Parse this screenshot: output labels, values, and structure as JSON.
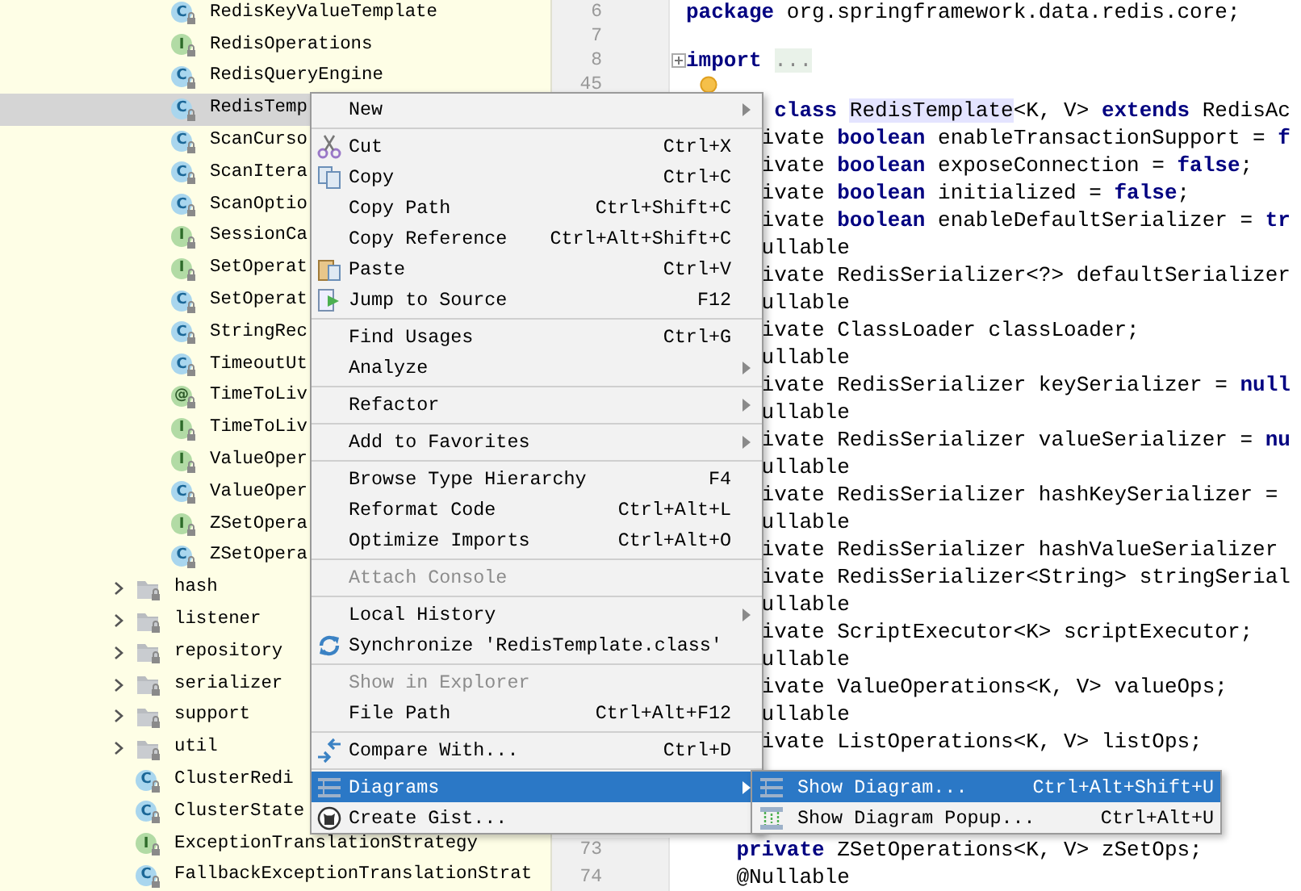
{
  "project_tree": {
    "items": [
      {
        "children": [
          {
            "label": "RedisKeyValueTemplate",
            "kind": "class",
            "icon_letter": "C",
            "selected": false
          },
          {
            "label": "RedisOperations",
            "kind": "interface",
            "icon_letter": "I",
            "selected": false
          },
          {
            "label": "RedisQueryEngine",
            "kind": "class",
            "icon_letter": "C",
            "selected": false
          },
          {
            "label": "RedisTemp",
            "kind": "class",
            "icon_letter": "C",
            "selected": true
          },
          {
            "label": "ScanCurso",
            "kind": "class",
            "icon_letter": "C",
            "selected": false
          },
          {
            "label": "ScanItera",
            "kind": "class",
            "icon_letter": "C",
            "selected": false
          },
          {
            "label": "ScanOptio",
            "kind": "class",
            "icon_letter": "C",
            "selected": false
          },
          {
            "label": "SessionCa",
            "kind": "interface",
            "icon_letter": "I",
            "selected": false
          },
          {
            "label": "SetOperat",
            "kind": "interface",
            "icon_letter": "I",
            "selected": false
          },
          {
            "label": "SetOperat",
            "kind": "class",
            "icon_letter": "C",
            "selected": false
          },
          {
            "label": "StringRec",
            "kind": "class",
            "icon_letter": "C",
            "selected": false
          },
          {
            "label": "TimeoutUt",
            "kind": "class",
            "icon_letter": "C",
            "selected": false
          },
          {
            "label": "TimeToLiv",
            "kind": "annotation",
            "icon_letter": "@",
            "selected": false
          },
          {
            "label": "TimeToLiv",
            "kind": "interface",
            "icon_letter": "I",
            "selected": false
          },
          {
            "label": "ValueOper",
            "kind": "interface",
            "icon_letter": "I",
            "selected": false
          },
          {
            "label": "ValueOper",
            "kind": "class",
            "icon_letter": "C",
            "selected": false
          },
          {
            "label": "ZSetOpera",
            "kind": "interface",
            "icon_letter": "I",
            "selected": false
          },
          {
            "label": "ZSetOpera",
            "kind": "class",
            "icon_letter": "C",
            "selected": false
          }
        ]
      },
      {
        "label": "hash",
        "kind": "package",
        "expanded": false,
        "selected": false
      },
      {
        "label": "listener",
        "kind": "package",
        "expanded": false,
        "selected": false
      },
      {
        "label": "repository",
        "kind": "package",
        "expanded": false,
        "selected": false
      },
      {
        "label": "serializer",
        "kind": "package",
        "expanded": false,
        "selected": false
      },
      {
        "label": "support",
        "kind": "package",
        "expanded": false,
        "selected": false
      },
      {
        "label": "util",
        "kind": "package",
        "expanded": false,
        "selected": false
      },
      {
        "label": "ClusterRedi",
        "kind": "class",
        "icon_letter": "C",
        "selected": false
      },
      {
        "label": "ClusterState",
        "kind": "class",
        "icon_letter": "C",
        "selected": false
      },
      {
        "label": "ExceptionTranslationStrategy",
        "kind": "interface",
        "icon_letter": "I",
        "selected": false
      },
      {
        "label": "FallbackExceptionTranslationStrat",
        "kind": "class",
        "icon_letter": "C",
        "selected": false
      }
    ]
  },
  "editor": {
    "lines": [
      {
        "number": "6",
        "kind": "top",
        "text": "**package** org.springframework.data.redis.core;"
      },
      {
        "number": "7"
      },
      {
        "number": "8",
        "kind": "top",
        "parts": [
          {
            "kind": "plain",
            "text": "**import** "
          },
          {
            "kind": "fold",
            "text": "..."
          }
        ]
      },
      {
        "number": "45"
      },
      {
        "kind": "covered-gap",
        "parts": [
          {
            "kind": "plain",
            "text": "**class** "
          },
          {
            "kind": "highlight",
            "text": "RedisTemplate"
          },
          {
            "kind": "plain",
            "text": "<K, V> **extends** RedisAc"
          }
        ]
      },
      {
        "kind": "covered",
        "text": "ivate **boolean** enableTransactionSupport = **f**"
      },
      {
        "kind": "covered",
        "text": "ivate **boolean** exposeConnection = **false**;"
      },
      {
        "kind": "covered",
        "text": "ivate **boolean** initialized = **false**;"
      },
      {
        "kind": "covered",
        "text": "ivate **boolean** enableDefaultSerializer = **tr**"
      },
      {
        "kind": "covered",
        "text": "ullable"
      },
      {
        "kind": "covered",
        "text": "ivate RedisSerializer<?> defaultSerializer"
      },
      {
        "kind": "covered",
        "text": "ullable"
      },
      {
        "kind": "covered",
        "text": "ivate ClassLoader classLoader;"
      },
      {
        "kind": "covered",
        "text": "ullable"
      },
      {
        "kind": "covered",
        "text": "ivate RedisSerializer keySerializer = **null**"
      },
      {
        "kind": "covered",
        "text": "ullable"
      },
      {
        "kind": "covered",
        "text": "ivate RedisSerializer valueSerializer = **nu**"
      },
      {
        "kind": "covered",
        "text": "ullable"
      },
      {
        "kind": "covered",
        "text": "ivate RedisSerializer hashKeySerializer ="
      },
      {
        "kind": "covered",
        "text": "ullable"
      },
      {
        "kind": "covered",
        "text": "ivate RedisSerializer hashValueSerializer"
      },
      {
        "kind": "covered",
        "text": "ivate RedisSerializer<String> stringSerial"
      },
      {
        "kind": "covered",
        "text": "ullable"
      },
      {
        "kind": "covered",
        "text": "ivate ScriptExecutor<K> scriptExecutor;"
      },
      {
        "kind": "covered",
        "text": "ullable"
      },
      {
        "kind": "covered",
        "text": "ivate ValueOperations<K, V> valueOps;"
      },
      {
        "kind": "covered",
        "text": "ullable"
      },
      {
        "kind": "covered",
        "text": "ivate ListOperations<K, V> listOps;"
      },
      {
        "number": "73",
        "kind": "member",
        "text": "**private** ZSetOperations<K, V> zSetOps;"
      },
      {
        "number": "74",
        "kind": "member",
        "text": "@Nullable"
      }
    ]
  },
  "context_menu": {
    "groups": [
      [
        {
          "label": "New",
          "submenu": true,
          "disabled": false,
          "selected": false
        }
      ],
      [
        {
          "label": "Cut",
          "shortcut": "Ctrl+X",
          "submenu": false,
          "disabled": false,
          "selected": false
        },
        {
          "label": "Copy",
          "shortcut": "Ctrl+C",
          "submenu": false,
          "disabled": false,
          "selected": false
        },
        {
          "label": "Copy Path",
          "shortcut": "Ctrl+Shift+C",
          "submenu": false,
          "disabled": false,
          "selected": false
        },
        {
          "label": "Copy Reference",
          "shortcut": "Ctrl+Alt+Shift+C",
          "submenu": false,
          "disabled": false,
          "selected": false
        },
        {
          "label": "Paste",
          "shortcut": "Ctrl+V",
          "submenu": false,
          "disabled": false,
          "selected": false
        },
        {
          "label": "Jump to Source",
          "shortcut": "F12",
          "submenu": false,
          "disabled": false,
          "selected": false
        }
      ],
      [
        {
          "label": "Find Usages",
          "shortcut": "Ctrl+G",
          "submenu": false,
          "disabled": false,
          "selected": false
        },
        {
          "label": "Analyze",
          "submenu": true,
          "disabled": false,
          "selected": false
        }
      ],
      [
        {
          "label": "Refactor",
          "submenu": true,
          "disabled": false,
          "selected": false
        }
      ],
      [
        {
          "label": "Add to Favorites",
          "submenu": true,
          "disabled": false,
          "selected": false
        }
      ],
      [
        {
          "label": "Browse Type Hierarchy",
          "shortcut": "F4",
          "submenu": false,
          "disabled": false,
          "selected": false
        },
        {
          "label": "Reformat Code",
          "shortcut": "Ctrl+Alt+L",
          "submenu": false,
          "disabled": false,
          "selected": false
        },
        {
          "label": "Optimize Imports",
          "shortcut": "Ctrl+Alt+O",
          "submenu": false,
          "disabled": false,
          "selected": false
        }
      ],
      [
        {
          "label": "Attach Console",
          "submenu": false,
          "disabled": true,
          "selected": false
        }
      ],
      [
        {
          "label": "Local History",
          "submenu": true,
          "disabled": false,
          "selected": false
        },
        {
          "label": "Synchronize 'RedisTemplate.class'",
          "submenu": false,
          "disabled": false,
          "selected": false
        }
      ],
      [
        {
          "label": "Show in Explorer",
          "submenu": false,
          "disabled": true,
          "selected": false
        },
        {
          "label": "File Path",
          "shortcut": "Ctrl+Alt+F12",
          "submenu": false,
          "disabled": false,
          "selected": false
        }
      ],
      [
        {
          "label": "Compare With...",
          "shortcut": "Ctrl+D",
          "submenu": false,
          "disabled": false,
          "selected": false
        }
      ],
      [
        {
          "label": "Diagrams",
          "submenu": true,
          "disabled": false,
          "selected": true
        },
        {
          "label": "Create Gist...",
          "submenu": false,
          "disabled": false,
          "selected": false
        }
      ]
    ]
  },
  "submenu": {
    "items": [
      {
        "label": "Show Diagram...",
        "shortcut": "Ctrl+Alt+Shift+U",
        "selected": true
      },
      {
        "label": "Show Diagram Popup...",
        "shortcut": "Ctrl+Alt+U",
        "selected": false
      }
    ]
  }
}
